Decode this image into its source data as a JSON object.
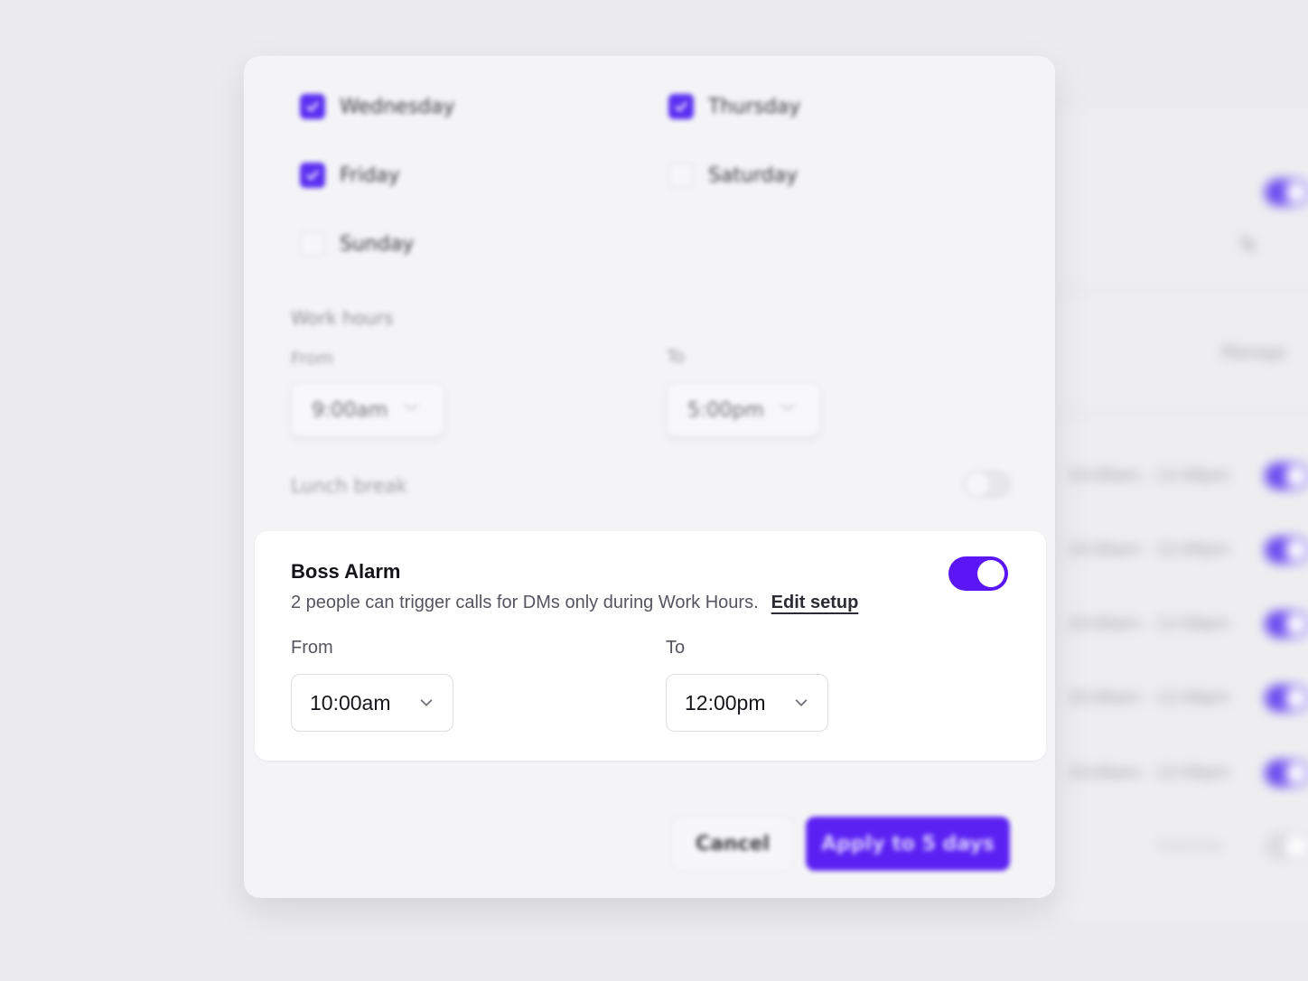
{
  "background": {
    "manage_label": "Manage",
    "schedule_rows": [
      "10:00am - 12:00pm",
      "10:00am - 12:00pm",
      "10:00am - 12:00pm",
      "10:00am - 12:00pm",
      "10:00am - 12:00pm"
    ],
    "inactive_label": "Inactive"
  },
  "days": [
    {
      "label": "Wednesday",
      "checked": true
    },
    {
      "label": "Thursday",
      "checked": true
    },
    {
      "label": "Friday",
      "checked": true
    },
    {
      "label": "Saturday",
      "checked": false
    },
    {
      "label": "Sunday",
      "checked": false
    }
  ],
  "work_hours": {
    "heading": "Work hours",
    "from_label": "From",
    "from_value": "9:00am",
    "to_label": "To",
    "to_value": "5:00pm"
  },
  "lunch_break": {
    "label": "Lunch break",
    "enabled": false
  },
  "boss_alarm": {
    "title": "Boss Alarm",
    "description": "2 people can trigger calls for DMs only during Work Hours.",
    "edit_link": "Edit setup",
    "enabled": true,
    "from_label": "From",
    "from_value": "10:00am",
    "to_label": "To",
    "to_value": "12:00pm"
  },
  "footer": {
    "cancel_label": "Cancel",
    "apply_label": "Apply to 5 days"
  },
  "colors": {
    "accent": "#5b16f5",
    "page_bg": "#ececef"
  }
}
